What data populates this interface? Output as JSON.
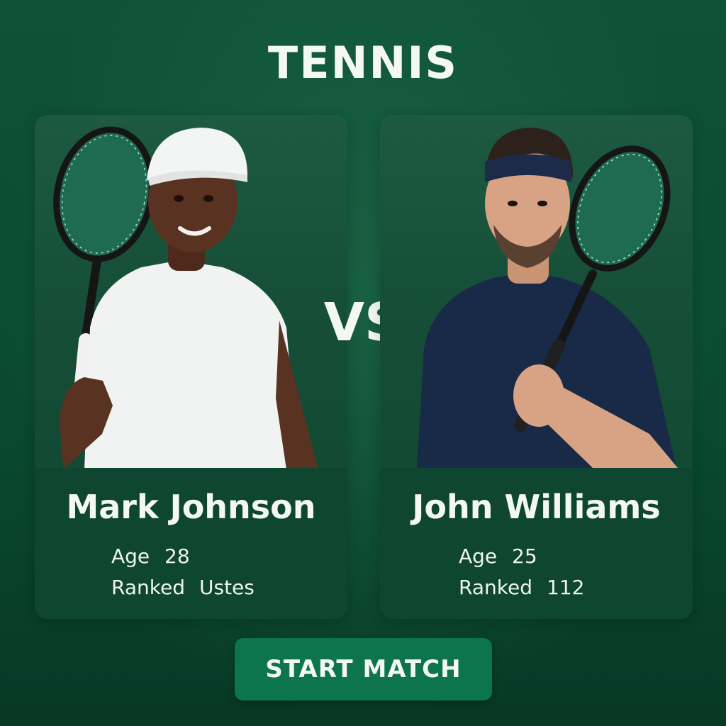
{
  "header": {
    "title": "TENNIS"
  },
  "versus_label": "VS",
  "players": [
    {
      "name": "Mark Johnson",
      "age_label": "Age",
      "age": "28",
      "rank_label": "Ranked",
      "rank": "Ustes"
    },
    {
      "name": "John Williams",
      "age_label": "Age",
      "age": "25",
      "rank_label": "Ranked",
      "rank": "112"
    }
  ],
  "actions": {
    "start_label": "START MATCH"
  },
  "icons": [
    "player-portrait-mark-johnson",
    "player-portrait-john-williams",
    "tennis-racket-icon"
  ],
  "colors": {
    "background": "#0b4a33",
    "card": "#124c36",
    "button": "#0c7550",
    "text": "#f4f8f5"
  }
}
